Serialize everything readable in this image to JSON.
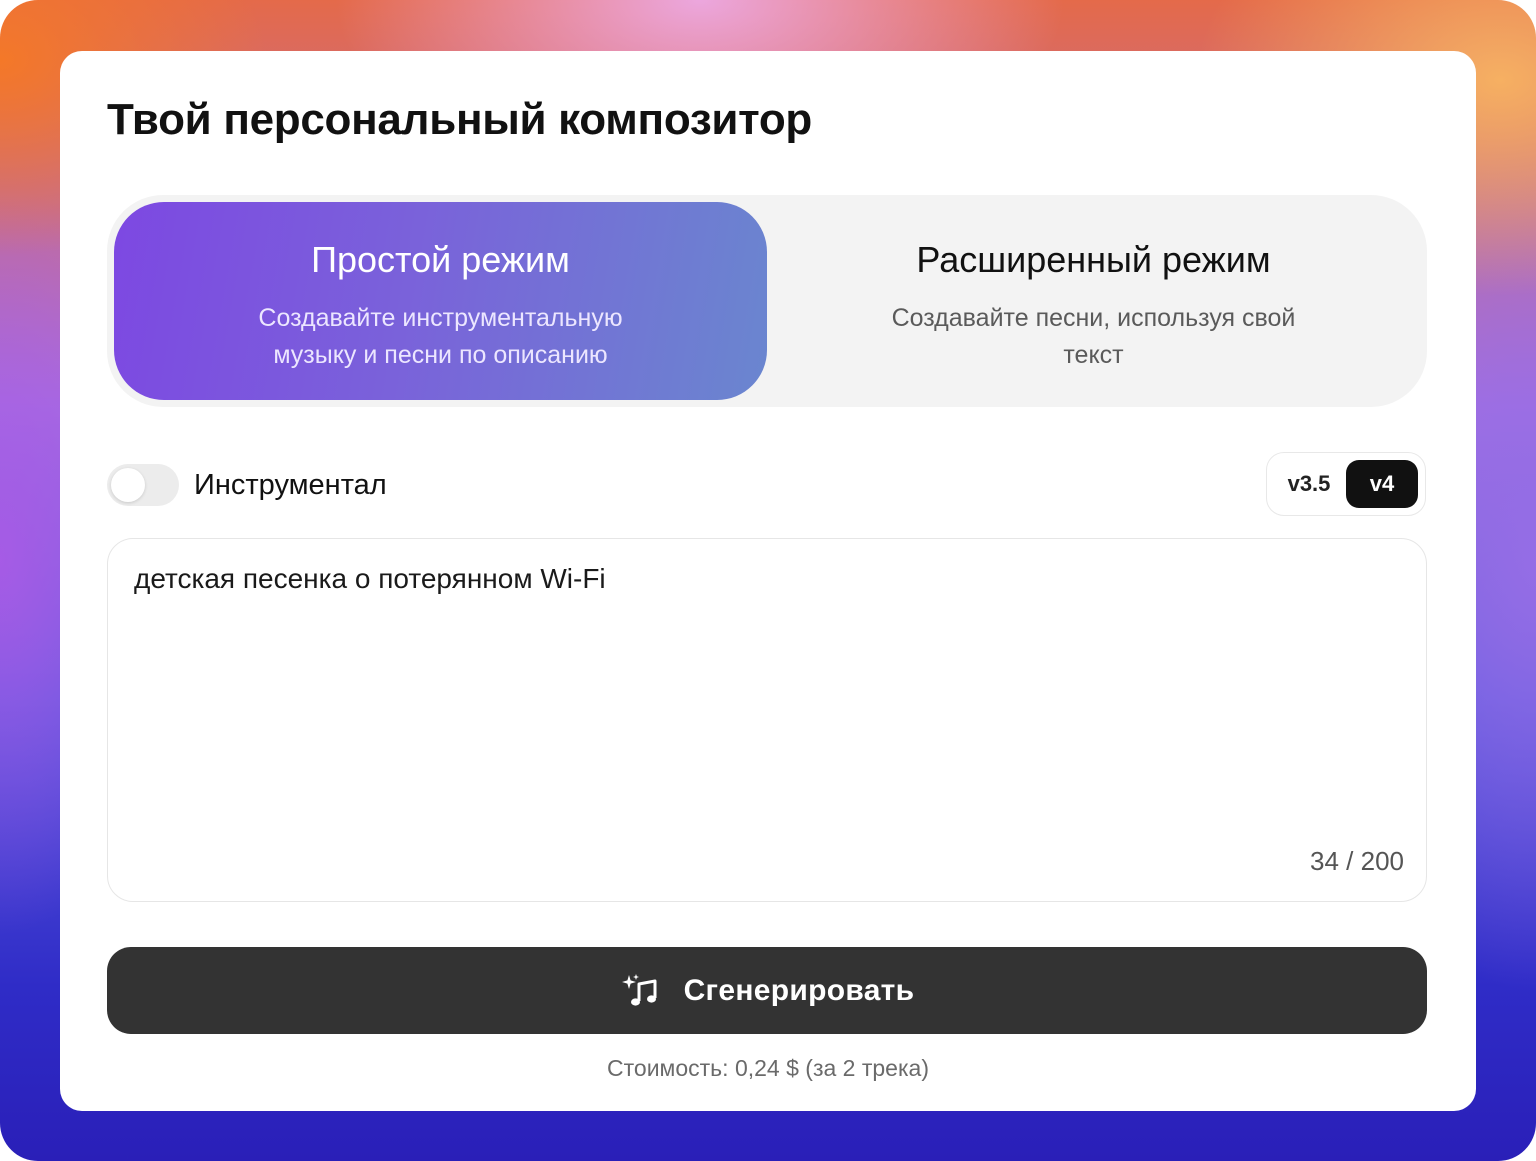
{
  "title": "Твой персональный композитор",
  "modes": {
    "simple": {
      "title": "Простой режим",
      "description": "Создавайте инструментальную музыку и песни по описанию",
      "selected": true
    },
    "advanced": {
      "title": "Расширенный режим",
      "description": "Создавайте песни, используя свой текст",
      "selected": false
    }
  },
  "instrumental": {
    "label": "Инструментал",
    "enabled": false
  },
  "versions": {
    "options": [
      "v3.5",
      "v4"
    ],
    "selected": "v4"
  },
  "prompt": {
    "value": "детская песенка о потерянном Wi-Fi",
    "counter": "34 / 200"
  },
  "generate": {
    "label": "Сгенерировать",
    "icon": "sparkle-music-note-icon"
  },
  "cost": "Стоимость: 0,24 $ (за 2 трека)",
  "colors": {
    "accent_start": "#7d48e2",
    "accent_end": "#6a86cf",
    "button_bg": "#333333",
    "version_active_bg": "#111111"
  }
}
